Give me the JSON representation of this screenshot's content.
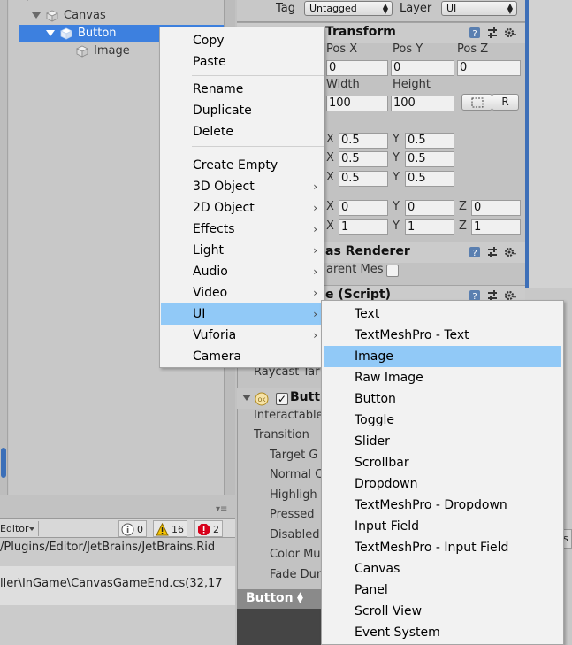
{
  "hierarchy": {
    "rows": [
      {
        "label": "Canvas"
      },
      {
        "label": "Button"
      },
      {
        "label": "Image"
      }
    ]
  },
  "inspector": {
    "tag_label": "Tag",
    "tag_value": "Untagged",
    "layer_label": "Layer",
    "layer_value": "UI",
    "rect_transform": {
      "title": "Transform",
      "pos_x_label": "Pos X",
      "pos_y_label": "Pos Y",
      "pos_z_label": "Pos Z",
      "pos_x": "0",
      "pos_y": "0",
      "pos_z": "0",
      "width_label": "Width",
      "height_label": "Height",
      "width": "100",
      "height": "100",
      "r_button": "R",
      "anchor_min": {
        "x": "0.5",
        "y": "0.5"
      },
      "anchor_max": {
        "x": "0.5",
        "y": "0.5"
      },
      "pivot": {
        "x": "0.5",
        "y": "0.5"
      },
      "rotation": {
        "x": "0",
        "y": "0",
        "z": "0"
      },
      "scale": {
        "x": "1",
        "y": "1",
        "z": "1"
      },
      "x_lbl": "X",
      "y_lbl": "Y",
      "z_lbl": "Z"
    },
    "canvas_renderer": {
      "title": "as Renderer",
      "field": "arent Mes"
    },
    "image_script": {
      "title": "e (Script)"
    },
    "raycast_label": "Raycast Tar",
    "button": {
      "title": "Butt",
      "fields": [
        "Interactable",
        "Transition",
        "Target G",
        "Normal C",
        "Highligh",
        "Pressed",
        "Disabled",
        "Color Mu",
        "Fade Dur"
      ]
    },
    "bottom_tab": "Button"
  },
  "console": {
    "editor_dropdown": "Editor",
    "counts": {
      "info": "0",
      "warn": "16",
      "error": "2"
    },
    "lines": [
      "/Plugins/Editor/JetBrains/JetBrains.Rid",
      "ller\\InGame\\CanvasGameEnd.cs(32,17"
    ]
  },
  "right_fragment": "s",
  "context_menu": {
    "items": [
      {
        "label": "Copy",
        "submenu": false
      },
      {
        "label": "Paste",
        "submenu": false
      },
      {
        "label": "Rename",
        "submenu": false
      },
      {
        "label": "Duplicate",
        "submenu": false
      },
      {
        "label": "Delete",
        "submenu": false
      },
      {
        "label": "Create Empty",
        "submenu": false
      },
      {
        "label": "3D Object",
        "submenu": true
      },
      {
        "label": "2D Object",
        "submenu": true
      },
      {
        "label": "Effects",
        "submenu": true
      },
      {
        "label": "Light",
        "submenu": true
      },
      {
        "label": "Audio",
        "submenu": true
      },
      {
        "label": "Video",
        "submenu": true
      },
      {
        "label": "UI",
        "submenu": true,
        "highlighted": true
      },
      {
        "label": "Vuforia",
        "submenu": true
      },
      {
        "label": "Camera",
        "submenu": false
      }
    ],
    "chevron": "›"
  },
  "ui_submenu": {
    "items": [
      "Text",
      "TextMeshPro - Text",
      "Image",
      "Raw Image",
      "Button",
      "Toggle",
      "Slider",
      "Scrollbar",
      "Dropdown",
      "TextMeshPro - Dropdown",
      "Input Field",
      "TextMeshPro - Input Field",
      "Canvas",
      "Panel",
      "Scroll View",
      "Event System"
    ],
    "highlighted": "Image"
  },
  "colors": {
    "selection_blue": "#3d80df",
    "menu_highlight": "#91c9f7",
    "panel_bg": "#c2c2c2"
  }
}
